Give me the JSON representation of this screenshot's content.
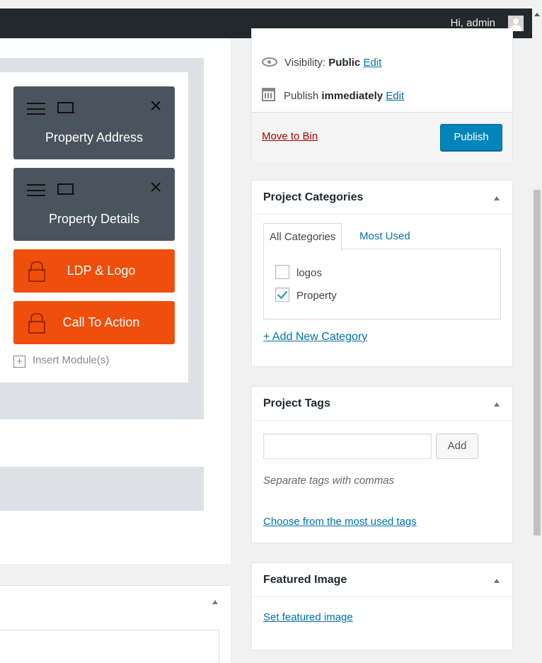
{
  "admin_bar": {
    "greeting": "Hi, admin"
  },
  "builder": {
    "modules": [
      {
        "title": "Property Address",
        "type": "editable"
      },
      {
        "title": "Property Details",
        "type": "editable"
      },
      {
        "title": "LDP & Logo",
        "type": "locked"
      },
      {
        "title": "Call To Action",
        "type": "locked"
      }
    ],
    "insert_label": "Insert Module(s)"
  },
  "publish": {
    "visibility_label": "Visibility:",
    "visibility_value": "Public",
    "visibility_edit": "Edit",
    "publish_label": "Publish",
    "publish_value": "immediately",
    "publish_edit": "Edit",
    "trash_label": "Move to Bin",
    "publish_button": "Publish"
  },
  "categories": {
    "title": "Project Categories",
    "tab_all": "All Categories",
    "tab_used": "Most Used",
    "items": [
      {
        "label": "logos",
        "checked": false
      },
      {
        "label": "Property",
        "checked": true
      }
    ],
    "add_link": "+ Add New Category"
  },
  "tags": {
    "title": "Project Tags",
    "input_value": "",
    "add_button": "Add",
    "help_text": "Separate tags with commas",
    "choose_link": "Choose from the most used tags"
  },
  "featured_image": {
    "title": "Featured Image",
    "set_link": "Set featured image"
  },
  "colors": {
    "admin_bar": "#23282d",
    "module_dark": "#4a545e",
    "module_locked": "#f04e0d",
    "primary_button": "#0085ba",
    "link": "#0073aa",
    "danger_link": "#a00"
  }
}
